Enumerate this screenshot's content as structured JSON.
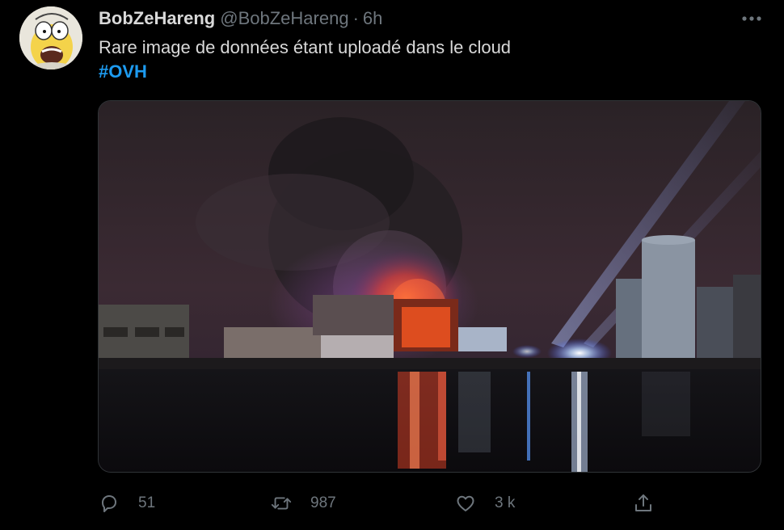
{
  "tweet": {
    "author": {
      "display_name": "BobZeHareng",
      "handle": "@BobZeHareng",
      "avatar_icon": "avatar-icon"
    },
    "separator": "·",
    "time": "6h",
    "text": "Rare image de données étant uploadé dans le cloud",
    "hashtag": "#OVH",
    "more_icon": "more-horizontal-icon"
  },
  "actions": {
    "reply": {
      "icon": "reply-icon",
      "count": "51"
    },
    "retweet": {
      "icon": "retweet-icon",
      "count": "987"
    },
    "like": {
      "icon": "heart-icon",
      "count": "3 k"
    },
    "share": {
      "icon": "share-icon"
    }
  },
  "colors": {
    "background": "#000000",
    "text": "#d9d9d9",
    "muted": "#6e767d",
    "accent": "#1d9bf0"
  }
}
